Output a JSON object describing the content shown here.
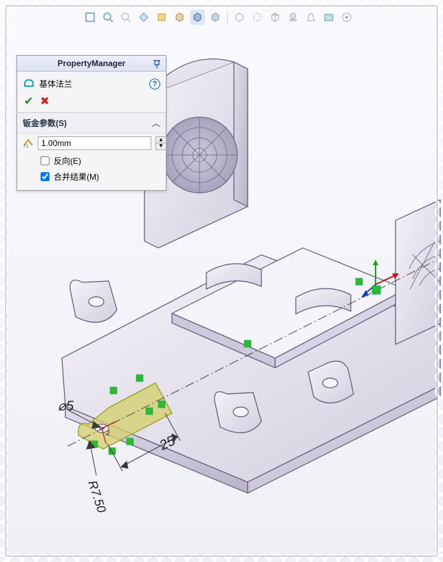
{
  "toolbar": {
    "icons": [
      "zoom-fit",
      "zoom-area",
      "zoom-in",
      "pan",
      "rotate",
      "section",
      "shaded-edges",
      "shaded",
      "hidden-removed",
      "hidden-visible",
      "wireframe",
      "shadow",
      "perspective",
      "scene"
    ]
  },
  "pm": {
    "title": "PropertyManager",
    "feature_name": "基体法兰",
    "section_label": "钣金参数(S)",
    "thickness_value": "1.00mm",
    "reverse_label": "反向(E)",
    "reverse_checked": false,
    "merge_label": "合并结果(M)",
    "merge_checked": true
  },
  "sketch": {
    "diameter_label": "⌀5",
    "radius_label": "R7.50",
    "length_label": "25"
  },
  "triad": {
    "x": "#c00",
    "y": "#0a0",
    "z": "#22c"
  }
}
